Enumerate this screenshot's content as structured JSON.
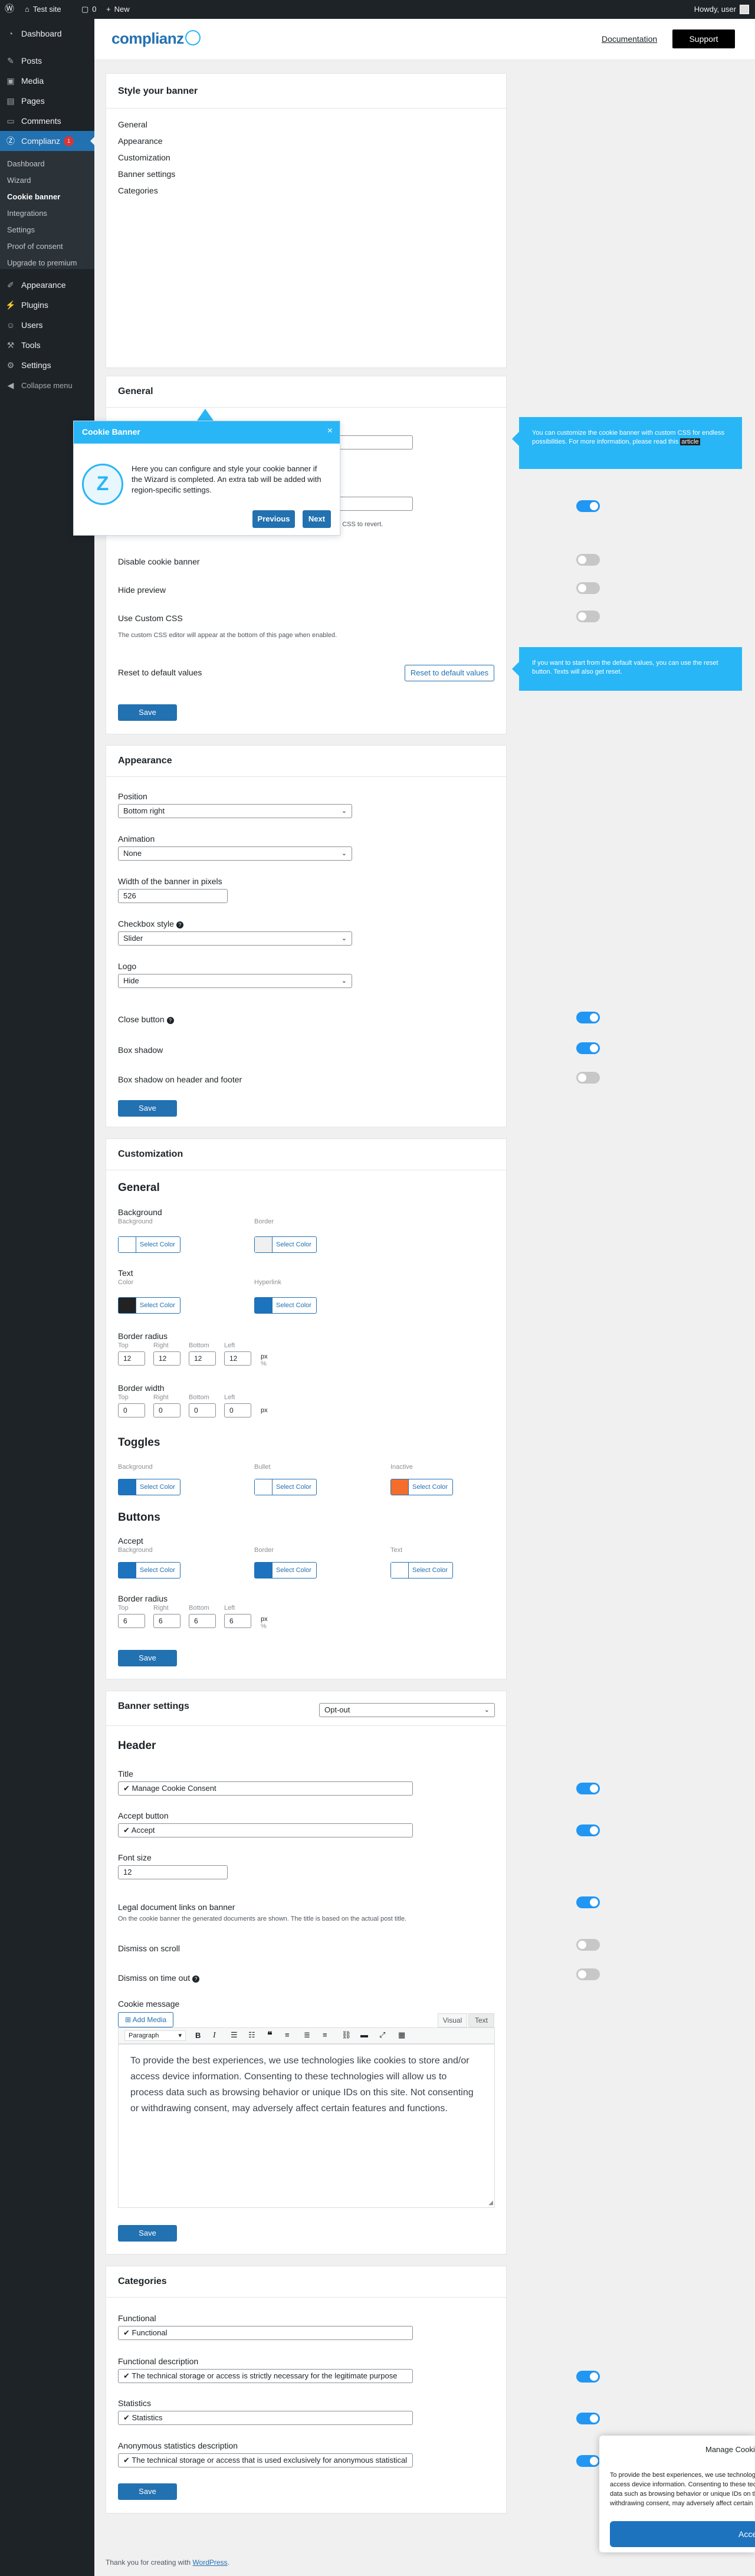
{
  "adminbar": {
    "site": "Test site",
    "new": "New",
    "howdy": "Howdy, user",
    "counts": [
      "0"
    ]
  },
  "sidebar": {
    "items": [
      {
        "label": "Dashboard",
        "icon": "dashboard-icon"
      },
      {
        "label": "Posts",
        "icon": "pin-icon"
      },
      {
        "label": "Media",
        "icon": "media-icon"
      },
      {
        "label": "Pages",
        "icon": "pages-icon"
      },
      {
        "label": "Comments",
        "icon": "comments-icon"
      },
      {
        "label": "Complianz",
        "icon": "complianz-icon",
        "badge": "1"
      },
      {
        "label": "Appearance",
        "icon": "brush-icon"
      },
      {
        "label": "Plugins",
        "icon": "plugin-icon"
      },
      {
        "label": "Users",
        "icon": "users-icon"
      },
      {
        "label": "Tools",
        "icon": "wrench-icon"
      },
      {
        "label": "Settings",
        "icon": "settings-icon"
      },
      {
        "label": "Collapse menu",
        "icon": "collapse-icon"
      }
    ],
    "submenu": [
      "Dashboard",
      "Wizard",
      "Cookie banner",
      "Integrations",
      "Settings",
      "Proof of consent",
      "Upgrade to premium"
    ]
  },
  "topbar": {
    "logo": "complianz",
    "documentation": "Documentation",
    "support": "Support"
  },
  "style_card": {
    "title": "Style your banner",
    "links": [
      "General",
      "Appearance",
      "Customization",
      "Banner settings",
      "Categories"
    ]
  },
  "general": {
    "title": "General",
    "revert_note": "to CSS to revert.",
    "disable_banner": "Disable cookie banner",
    "hide_preview": "Hide preview",
    "use_css": "Use Custom CSS",
    "css_desc": "The custom CSS editor will appear at the bottom of this page when enabled.",
    "reset_label": "Reset to default values",
    "reset_button": "Reset to default values",
    "save": "Save"
  },
  "tour": {
    "title": "Cookie Banner",
    "close": "×",
    "body": "Here you can configure and style your cookie banner if the Wizard is completed. An extra tab will be added with region-specific settings.",
    "previous": "Previous",
    "next": "Next"
  },
  "tips": {
    "css_tip_text": "You can customize the cookie banner with custom CSS for endless possibilities. For more information, please read this",
    "css_tip_link": "article",
    "reset_tip": "If you want to start from the default values, you can use the reset button. Texts will also get reset."
  },
  "appearance": {
    "title": "Appearance",
    "position_label": "Position",
    "position_value": "Bottom right",
    "animation_label": "Animation",
    "animation_value": "None",
    "width_label": "Width of the banner in pixels",
    "width_value": "526",
    "checkbox_label": "Checkbox style",
    "checkbox_value": "Slider",
    "logo_label": "Logo",
    "logo_value": "Hide",
    "close_button": "Close button",
    "box_shadow": "Box shadow",
    "box_shadow_hf": "Box shadow on header and footer",
    "save": "Save"
  },
  "customization": {
    "title": "Customization",
    "general": "General",
    "background": "Background",
    "bg_sub": "Background",
    "border_sub": "Border",
    "text": "Text",
    "color_sub": "Color",
    "hyperlink_sub": "Hyperlink",
    "select_color": "Select Color",
    "border_radius": "Border radius",
    "border_width": "Border width",
    "sides": [
      "Top",
      "Right",
      "Bottom",
      "Left"
    ],
    "radius_values": [
      "12",
      "12",
      "12",
      "12"
    ],
    "width_values": [
      "0",
      "0",
      "0",
      "0"
    ],
    "units": [
      "px",
      "%"
    ],
    "toggles": "Toggles",
    "toggles_subs": [
      "Background",
      "Bullet",
      "Inactive"
    ],
    "buttons": "Buttons",
    "accept": "Accept",
    "accept_subs": [
      "Background",
      "Border",
      "Text"
    ],
    "btn_radius_values": [
      "6",
      "6",
      "6",
      "6"
    ],
    "save": "Save"
  },
  "colors": {
    "white": "#ffffff",
    "lightgray": "#f0f0f0",
    "black": "#222222",
    "blue": "#1e73be",
    "orange": "#f46d2b",
    "primary": "#2271b1",
    "tip": "#29b6f6"
  },
  "banner_settings": {
    "title": "Banner settings",
    "type_value": "Opt-out",
    "header": "Header",
    "title_label": "Title",
    "title_value": "Manage Cookie Consent",
    "accept_label": "Accept button",
    "accept_value": "Accept",
    "font_label": "Font size",
    "font_value": "12",
    "legal_label": "Legal document links on banner",
    "legal_desc": "On the cookie banner the generated documents are shown. The title is based on the actual post title.",
    "dismiss_scroll": "Dismiss on scroll",
    "dismiss_time": "Dismiss on time out",
    "cookie_message": "Cookie message",
    "add_media": "Add Media",
    "tab_visual": "Visual",
    "tab_text": "Text",
    "paragraph": "Paragraph",
    "message": "To provide the best experiences, we use technologies like cookies to store and/or access device information. Consenting to these technologies will allow us to process data such as browsing behavior or unique IDs on this site. Not consenting or withdrawing consent, may adversely affect certain features and functions.",
    "save": "Save"
  },
  "categories": {
    "title": "Categories",
    "functional_label": "Functional",
    "functional_value": "Functional",
    "func_desc_label": "Functional description",
    "func_desc_value": "The technical storage or access is strictly necessary for the legitimate purpose",
    "stats_label": "Statistics",
    "stats_value": "Statistics",
    "anon_label": "Anonymous statistics description",
    "anon_value": "The technical storage or access that is used exclusively for anonymous statistical",
    "save": "Save"
  },
  "footer": {
    "text": "Thank you for creating with",
    "link": "WordPress",
    "suffix": "."
  },
  "cookie_banner": {
    "title": "Manage Cookie Consent",
    "text": "To provide the best experiences, we use technologies like cookies to store and/or access device information. Consenting to these technologies will allow us to process data such as browsing behavior or unique IDs on this site. Not consenting or withdrawing consent, may adversely affect certain features and functions.",
    "accept": "Accept"
  }
}
